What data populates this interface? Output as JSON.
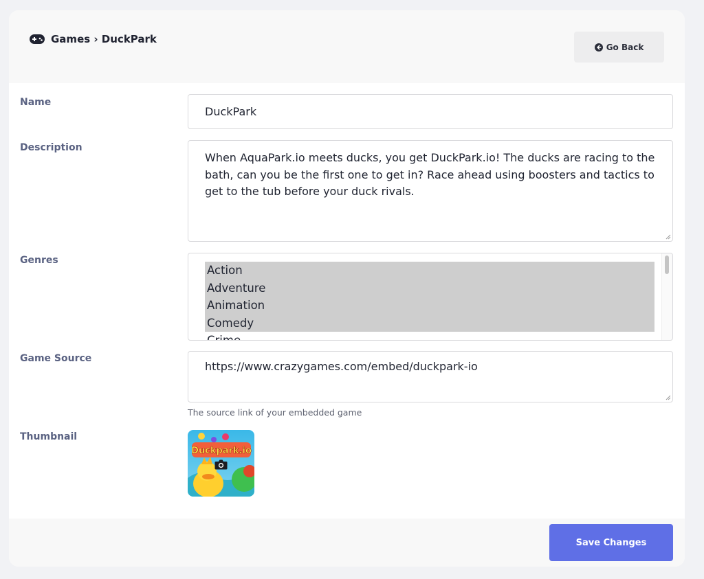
{
  "header": {
    "breadcrumb": "Games › DuckPark",
    "back_label": "Go Back"
  },
  "form": {
    "name_label": "Name",
    "name_value": "DuckPark",
    "description_label": "Description",
    "description_value": "When AquaPark.io meets ducks, you get DuckPark.io! The ducks are racing to the bath, can you be the first one to get in? Race ahead using boosters and tactics to get to the tub before your duck rivals.",
    "genres_label": "Genres",
    "genres": [
      {
        "label": "Action",
        "selected": true
      },
      {
        "label": "Adventure",
        "selected": true
      },
      {
        "label": "Animation",
        "selected": true
      },
      {
        "label": "Comedy",
        "selected": true
      },
      {
        "label": "Crime",
        "selected": false
      }
    ],
    "source_label": "Game Source",
    "source_value": "https://www.crazygames.com/embed/duckpark-io",
    "source_help": "The source link of your embedded game",
    "thumbnail_label": "Thumbnail",
    "thumbnail_logo_text": "Duckpark.io"
  },
  "footer": {
    "save_label": "Save Changes"
  },
  "colors": {
    "accent": "#5f6fe6",
    "label": "#5a6282",
    "selected_option": "#cecece"
  },
  "icons": {
    "breadcrumb": "gamepad-icon",
    "back": "arrow-left-circle-icon",
    "thumbnail_overlay": "camera-icon"
  }
}
